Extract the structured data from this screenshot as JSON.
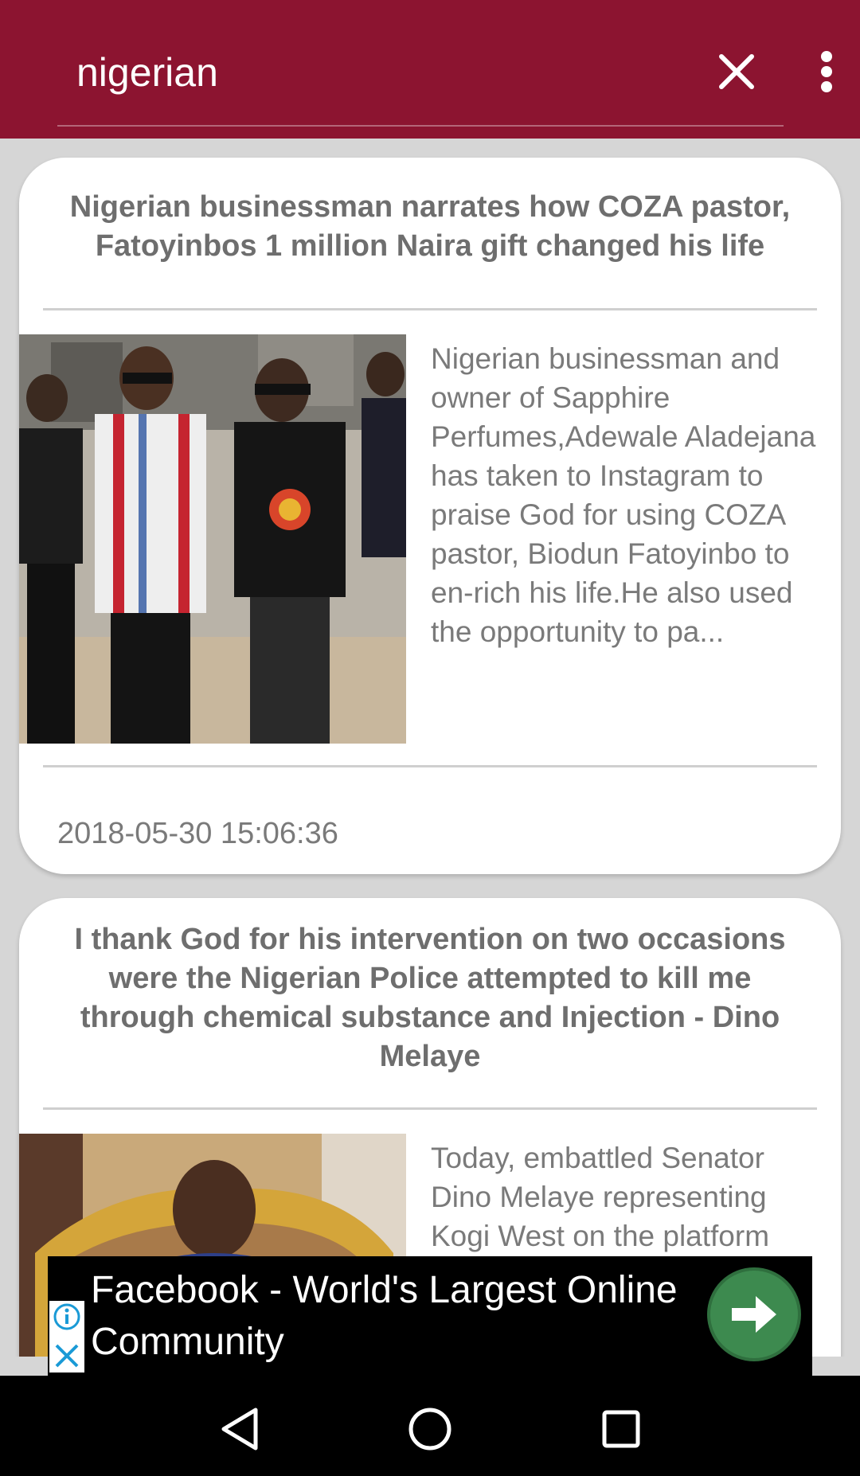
{
  "search": {
    "query": "nigerian",
    "clear_icon": "close-icon",
    "menu_icon": "more-vert-icon"
  },
  "articles": [
    {
      "title": "Nigerian businessman narrates how COZA pastor, Fatoyinbos 1 million Naira gift changed his life",
      "excerpt": "Nigerian businessman and owner of Sapphire Perfumes,Adewale Aladejana has taken to Instagram to praise God for using COZA pastor, Biodun Fatoyinbo to en-rich his life.He also used the opportunity to pa...",
      "timestamp": "2018-05-30 15:06:36"
    },
    {
      "title": "I thank God for his intervention on two occasions were the Nigerian Police attempted to kill me through chemical substance and Injection - Dino Melaye",
      "excerpt": "Today, embattled Senator Dino Melaye representing Kogi West on the platform"
    }
  ],
  "ad": {
    "text": "Facebook - World's Largest Online Community",
    "cta_icon": "arrow-right-icon",
    "info_icon": "info-icon",
    "close_icon": "close-icon"
  },
  "navbar": {
    "back_icon": "back-triangle-icon",
    "home_icon": "home-circle-icon",
    "recents_icon": "recents-square-icon"
  },
  "colors": {
    "appbar": "#8c1430",
    "background": "#d6d6d6",
    "card": "#ffffff",
    "text_gray": "#6e6e6e",
    "ad_button": "#3d8a4f"
  }
}
